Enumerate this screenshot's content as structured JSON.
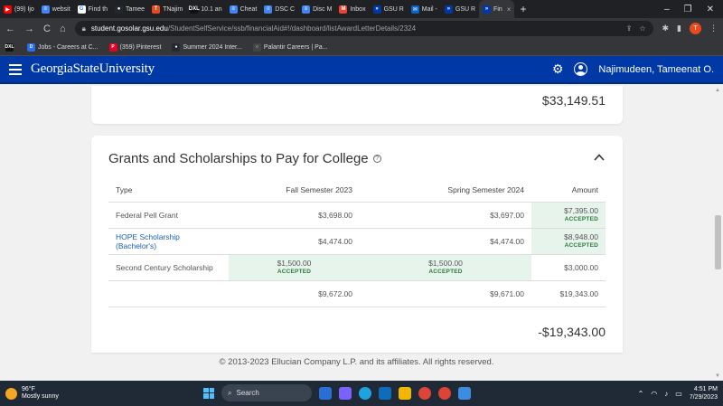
{
  "browser": {
    "tabs": [
      {
        "title": "(99) Ijo",
        "color": "#ff0000",
        "glyph": "▶"
      },
      {
        "title": "websit",
        "color": "#4285f4",
        "glyph": "≡"
      },
      {
        "title": "Find th",
        "color": "#ffffff",
        "glyph": "G"
      },
      {
        "title": "Tamee",
        "color": "#24292f",
        "glyph": "●"
      },
      {
        "title": "TNajim",
        "color": "#e8491d",
        "glyph": "T"
      },
      {
        "title": "10.1 an",
        "color": "#111111",
        "glyph": "DXL"
      },
      {
        "title": "Cheat",
        "color": "#4285f4",
        "glyph": "≡"
      },
      {
        "title": "DSC C",
        "color": "#4285f4",
        "glyph": "≡"
      },
      {
        "title": "Disc M",
        "color": "#4285f4",
        "glyph": "≡"
      },
      {
        "title": "Inbox",
        "color": "#ea4335",
        "glyph": "M"
      },
      {
        "title": "GSU R",
        "color": "#0039a6",
        "glyph": "»"
      },
      {
        "title": "Mail -",
        "color": "#0a66c2",
        "glyph": "✉"
      },
      {
        "title": "GSU R",
        "color": "#0039a6",
        "glyph": "»"
      },
      {
        "title": "Fin",
        "color": "#0039a6",
        "glyph": "»"
      }
    ],
    "new_tab": "+",
    "url_host": "student.gosolar.gsu.edu",
    "url_path": "/StudentSelfService/ssb/financialAid#!/dashboard/listAwardLetterDetails/2324",
    "profile_initial": "T",
    "bookmarks": [
      {
        "label": "",
        "color": "#111111",
        "glyph": "DXL"
      },
      {
        "label": "Jobs - Careers at C...",
        "color": "#2a6df4",
        "glyph": "D"
      },
      {
        "label": "(359) Pinterest",
        "color": "#e60023",
        "glyph": "P"
      },
      {
        "label": "Summer 2024 Inter...",
        "color": "#24292f",
        "glyph": "●"
      },
      {
        "label": "Palantir Careers | Pa...",
        "color": "#444444",
        "glyph": "○"
      }
    ]
  },
  "app": {
    "logo_text": "GeorgiaStateUniversity",
    "user_name": "Najimudeen, Tameenat O."
  },
  "summary": {
    "total": "$33,149.51"
  },
  "grants": {
    "title": "Grants and Scholarships to Pay for College",
    "headers": {
      "type": "Type",
      "fall": "Fall Semester 2023",
      "spring": "Spring Semester 2024",
      "amount": "Amount"
    },
    "rows": [
      {
        "type": "Federal Pell Grant",
        "fall": "$3,698.00",
        "spring": "$3,697.00",
        "amount": "$7,395.00",
        "amount_status": "ACCEPTED"
      },
      {
        "type": "HOPE Scholarship (Bachelor's)",
        "fall": "$4,474.00",
        "spring": "$4,474.00",
        "amount": "$8,948.00",
        "amount_status": "ACCEPTED"
      },
      {
        "type": "Second Century Scholarship",
        "fall": "$1,500.00",
        "fall_status": "ACCEPTED",
        "spring": "$1,500.00",
        "spring_status": "ACCEPTED",
        "amount": "$3,000.00"
      }
    ],
    "totals": {
      "fall": "$9,672.00",
      "spring": "$9,671.00",
      "amount": "$19,343.00"
    },
    "remaining": "-$19,343.00"
  },
  "footer": {
    "text": "© 2013-2023 Ellucian Company L.P. and its affiliates. All rights reserved."
  },
  "taskbar": {
    "temperature": "96°F",
    "condition": "Mostly sunny",
    "search_label": "Search",
    "time": "4:51 PM",
    "date": "7/29/2023"
  }
}
